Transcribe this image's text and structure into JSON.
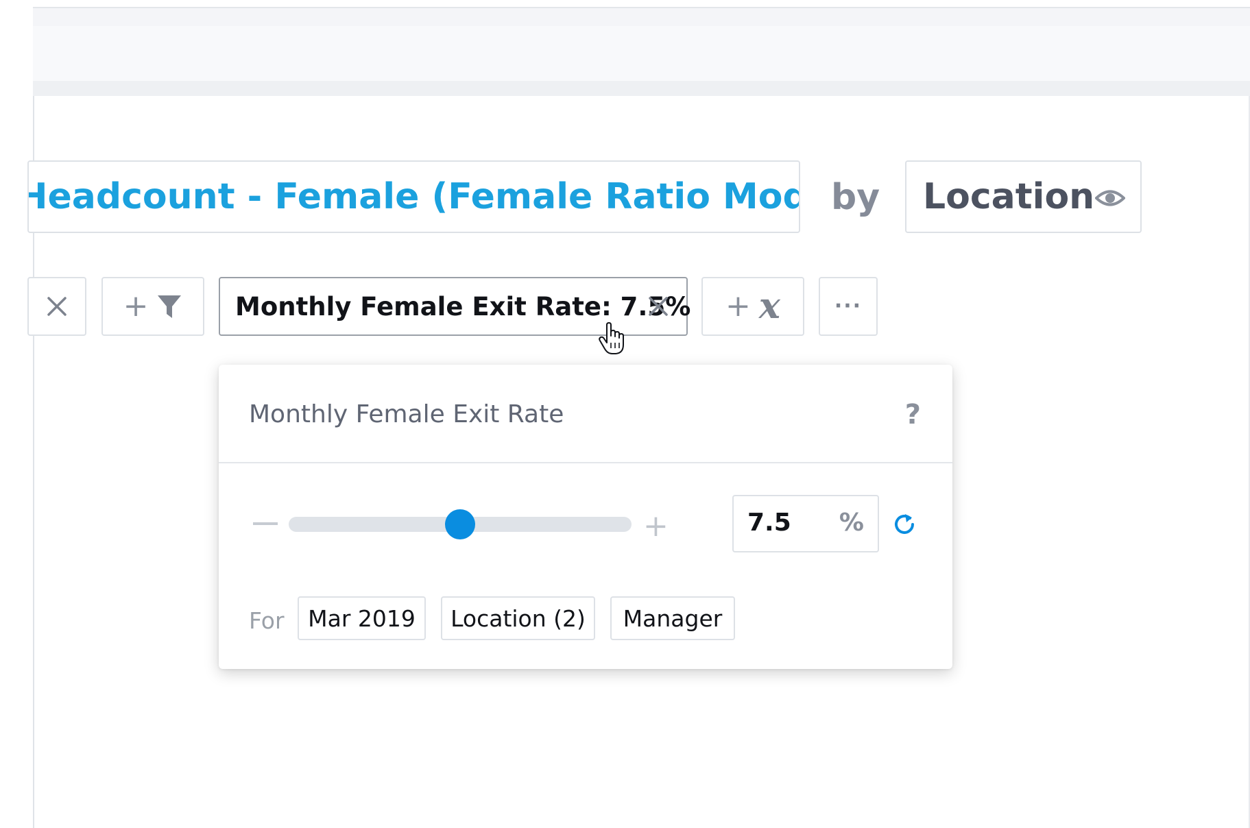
{
  "header": {
    "metric_title": "Headcount - Female (Female Ratio Model)",
    "by_label": "by",
    "dimension": "Location"
  },
  "chips": {
    "scenario_label": "Monthly Female Exit Rate: 7.5%"
  },
  "popover": {
    "title": "Monthly Female Exit Rate",
    "help": "?",
    "slider_fraction": 0.5,
    "value": "7.5",
    "unit": "%",
    "for_label": "For",
    "tags": [
      "Mar 2019",
      "Location (2)",
      "Manager"
    ]
  },
  "colors": {
    "accent_blue": "#1ba1de",
    "slider_blue": "#0a8de0",
    "text_dark": "#111318",
    "muted": "#8a909b"
  },
  "icons": [
    "eye-icon",
    "close-icon",
    "filter-icon",
    "variable-icon",
    "more-icon",
    "help-icon",
    "minus-icon",
    "plus-icon",
    "reset-icon",
    "hand-cursor-icon"
  ]
}
